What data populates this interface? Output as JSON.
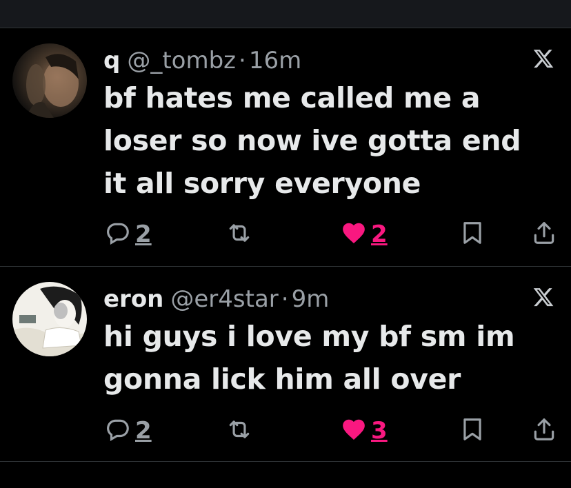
{
  "tweets": [
    {
      "name": "q",
      "handle": "@_tombz",
      "dot": "·",
      "time": "16m",
      "text": "bf hates me called me a loser so now ive gotta end it all sorry everyone",
      "replies": "2",
      "likes": "2",
      "liked": true
    },
    {
      "name": "eron",
      "handle": "@er4star",
      "dot": "·",
      "time": "9m",
      "text": "hi guys i love my bf sm im gonna lick him all over",
      "replies": "2",
      "likes": "3",
      "liked": true
    }
  ],
  "icons": {
    "reply": "reply-icon",
    "retweet": "retweet-icon",
    "like": "heart-icon",
    "bookmark": "bookmark-icon",
    "share": "share-icon",
    "close": "x-logo-icon"
  },
  "colors": {
    "background": "#000000",
    "text": "#e7e9ea",
    "muted": "#9aa0a6",
    "like": "#f91880",
    "divider": "#2f3336"
  }
}
